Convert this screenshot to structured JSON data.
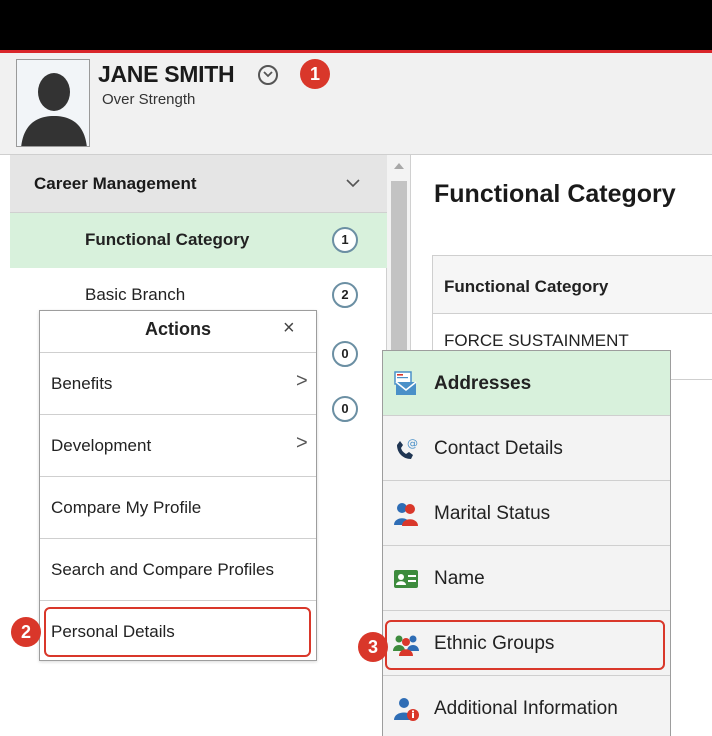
{
  "profile": {
    "name": "JANE SMITH",
    "status": "Over Strength"
  },
  "markers": [
    "1",
    "2",
    "3"
  ],
  "sidebar": {
    "section_title": "Career Management",
    "items": [
      {
        "label": "Functional Category",
        "count": "1",
        "active": true
      },
      {
        "label": "Basic Branch",
        "count": "2",
        "active": false
      },
      {
        "label": "",
        "count": "0",
        "active": false
      },
      {
        "label": "",
        "count": "0",
        "active": false
      }
    ]
  },
  "main": {
    "title": "Functional Category",
    "table": {
      "header": "Functional Category",
      "value": "FORCE SUSTAINMENT"
    }
  },
  "actions_menu": {
    "title": "Actions",
    "close_glyph": "×",
    "items": [
      {
        "label": "Benefits",
        "arrow": ">"
      },
      {
        "label": "Development",
        "arrow": ">"
      },
      {
        "label": "Compare My Profile",
        "arrow": ""
      },
      {
        "label": "Search and Compare Profiles",
        "arrow": ""
      },
      {
        "label": "Personal Details",
        "arrow": ""
      }
    ]
  },
  "personal_details_menu": {
    "items": [
      {
        "label": "Addresses",
        "icon": "address-envelope-icon",
        "active": true
      },
      {
        "label": "Contact Details",
        "icon": "phone-at-icon",
        "active": false
      },
      {
        "label": "Marital Status",
        "icon": "couple-icon",
        "active": false
      },
      {
        "label": "Name",
        "icon": "id-card-icon",
        "active": false
      },
      {
        "label": "Ethnic Groups",
        "icon": "group-people-icon",
        "active": false
      },
      {
        "label": "Additional Information",
        "icon": "person-info-icon",
        "active": false
      }
    ]
  },
  "colors": {
    "accent_red": "#d9372a",
    "active_green": "#d8f1dc",
    "topbar": "#000000"
  }
}
